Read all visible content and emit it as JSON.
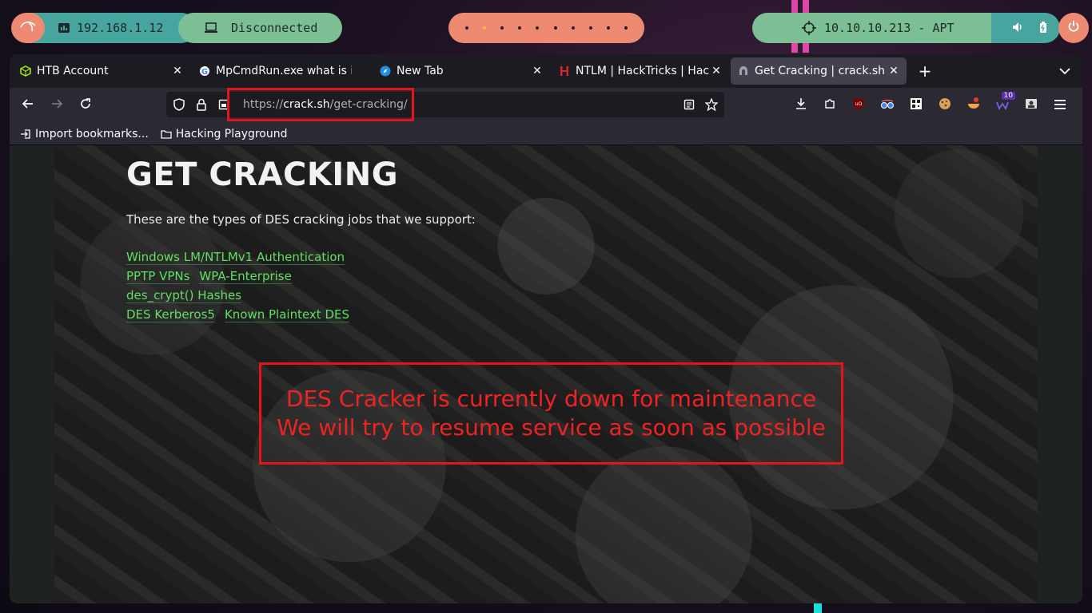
{
  "panel": {
    "local_ip": "192.168.1.12",
    "vpn_status": "Disconnected",
    "target": "10.10.10.213 - APT",
    "workspaces": [
      "1",
      "2",
      "3",
      "4",
      "5",
      "6",
      "7",
      "8",
      "9",
      "10"
    ],
    "active_workspace_index": 1,
    "colors": {
      "salmon": "#ef8a72",
      "teal": "#46a69f",
      "green": "#7dbf94"
    }
  },
  "tabs": [
    {
      "label": "HTB Account",
      "icon": "htb-cube-icon",
      "active": false
    },
    {
      "label": "MpCmdRun.exe what is it",
      "icon": "google-g-icon",
      "active": false
    },
    {
      "label": "New Tab",
      "icon": "firefox-compass-icon",
      "active": false
    },
    {
      "label": "NTLM | HackTricks | HackTricks",
      "icon": "hacktricks-h-icon",
      "active": false
    },
    {
      "label": "Get Cracking | crack.sh",
      "icon": "crack-sh-icon",
      "active": true
    }
  ],
  "urlbar": {
    "scheme": "https://",
    "host": "crack.sh",
    "path": "/get-cracking/"
  },
  "bookmarks": [
    {
      "label": "Import bookmarks...",
      "icon": "import-icon"
    },
    {
      "label": "Hacking Playground",
      "icon": "folder-icon"
    }
  ],
  "toolbar": {
    "badge_count": "10"
  },
  "page": {
    "title": "GET CRACKING",
    "intro": "These are the types of DES cracking jobs that we support:",
    "link_rows": [
      [
        "Windows LM/NTLMv1 Authentication"
      ],
      [
        "PPTP VPNs",
        "WPA-Enterprise"
      ],
      [
        "des_crypt() Hashes"
      ],
      [
        "DES Kerberos5",
        "Known Plaintext DES"
      ]
    ],
    "notice": {
      "line1": "DES Cracker is currently down for maintenance",
      "line2": "We will try to resume service as soon as possible"
    },
    "colors": {
      "link": "#5fe05f",
      "notice": "#ee2222",
      "highlight": "#e3141c"
    }
  }
}
